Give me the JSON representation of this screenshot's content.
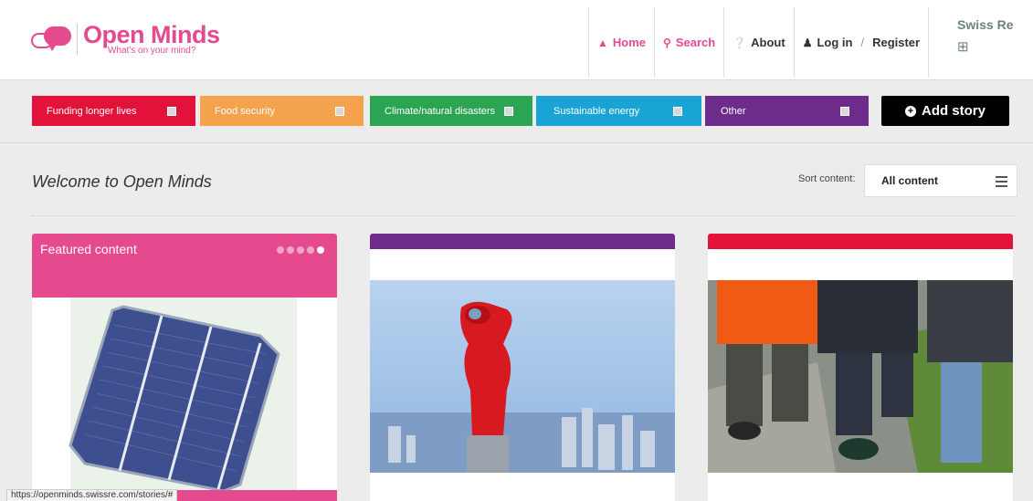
{
  "logo": {
    "title": "Open Minds",
    "subtitle": "What's on your mind?"
  },
  "nav": {
    "home": "Home",
    "search": "Search",
    "about": "About",
    "login": "Log in",
    "separator": "/",
    "register": "Register"
  },
  "brand": {
    "name": "Swiss Re"
  },
  "categories": [
    {
      "label": "Funding longer lives",
      "color": "#e2123b"
    },
    {
      "label": "Food security",
      "color": "#f4a24d"
    },
    {
      "label": "Climate/natural disasters",
      "color": "#2ba554"
    },
    {
      "label": "Sustainable energy",
      "color": "#1aa3d5"
    },
    {
      "label": "Other",
      "color": "#6d2b8b"
    }
  ],
  "add_story": {
    "label": "Add story"
  },
  "main": {
    "welcome": "Welcome to Open Minds",
    "sort_label": "Sort content:",
    "sort_value": "All content"
  },
  "cards": {
    "featured_title": "Featured content",
    "slide_count": 5,
    "active_slide": 5
  },
  "status_bar": {
    "url": "https://openminds.swissre.com/stories/#"
  },
  "colors": {
    "accent": "#e5498e",
    "brand": "#6b8577"
  }
}
